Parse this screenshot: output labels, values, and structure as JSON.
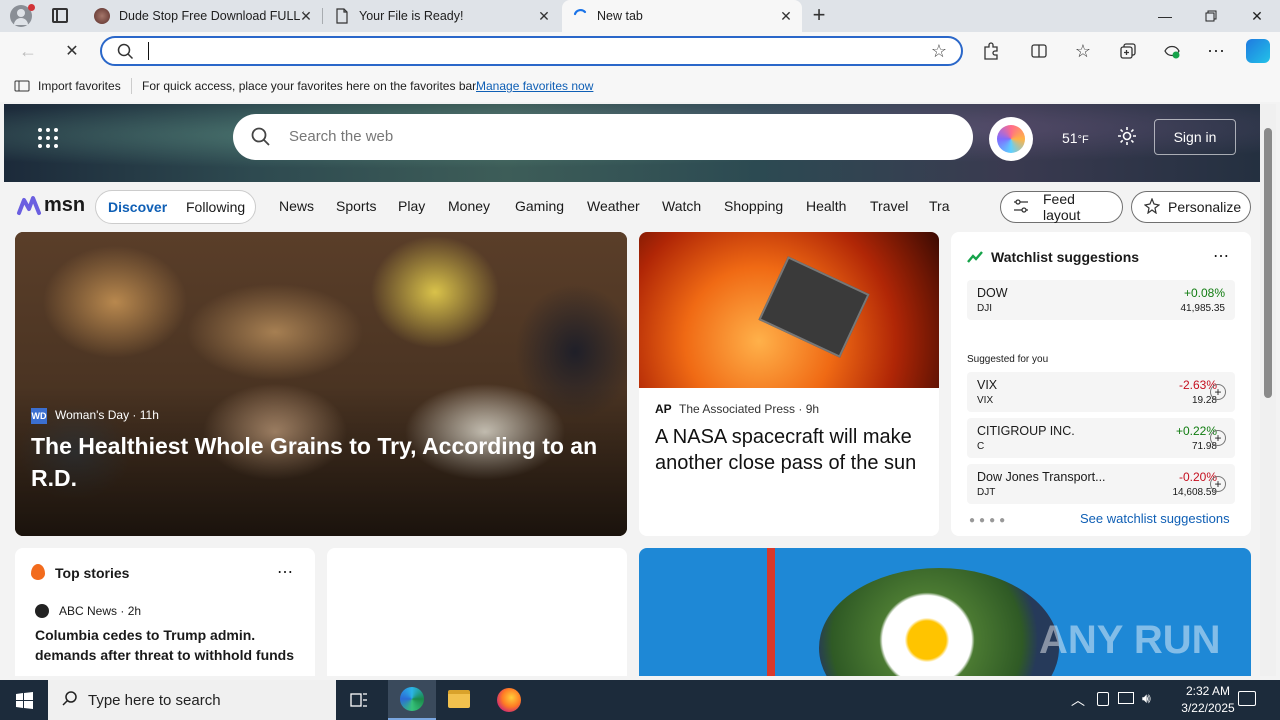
{
  "browser": {
    "tabs": [
      {
        "label": "Dude Stop Free Download FULL V",
        "active": false
      },
      {
        "label": "Your File is Ready!",
        "active": false
      },
      {
        "label": "New tab",
        "active": true
      }
    ],
    "address_value": "",
    "favorites_bar": {
      "import_label": "Import favorites",
      "hint": "For quick access, place your favorites here on the favorites bar.",
      "manage_link": "Manage favorites now"
    }
  },
  "msn": {
    "search_placeholder": "Search the web",
    "temperature": "51",
    "temp_unit": "°F",
    "sign_in": "Sign in",
    "logo": "msn",
    "tabs": [
      "Discover",
      "Following"
    ],
    "nav": [
      "News",
      "Sports",
      "Play",
      "Money",
      "Gaming",
      "Weather",
      "Watch",
      "Shopping",
      "Health",
      "Travel",
      "Tra"
    ],
    "feed_layout": "Feed layout",
    "personalize": "Personalize",
    "hero_story": {
      "source": "Woman's Day",
      "age": "11h",
      "title": "The Healthiest Whole Grains to Try, According to an R.D."
    },
    "second_story": {
      "source": "The Associated Press",
      "age": "9h",
      "title": "A NASA spacecraft will make another close pass of the sun"
    },
    "watchlist": {
      "title": "Watchlist suggestions",
      "main": {
        "name": "DOW",
        "symbol": "DJI",
        "change": "+0.08%",
        "price": "41,985.35"
      },
      "suggested_label": "Suggested for you",
      "suggested": [
        {
          "name": "VIX",
          "symbol": "VIX",
          "change": "-2.63%",
          "price": "19.28",
          "dir": "down"
        },
        {
          "name": "CITIGROUP INC.",
          "symbol": "C",
          "change": "+0.22%",
          "price": "71.98",
          "dir": "up"
        },
        {
          "name": "Dow Jones Transport...",
          "symbol": "DJT",
          "change": "-0.20%",
          "price": "14,608.59",
          "dir": "down"
        }
      ],
      "see_link": "See watchlist suggestions"
    },
    "top_stories": {
      "title": "Top stories",
      "source": "ABC News",
      "age": "2h",
      "headline": "Columbia cedes to Trump admin. demands after threat to withhold funds"
    },
    "watermark": "ANY RUN"
  },
  "taskbar": {
    "search_placeholder": "Type here to search",
    "time": "2:32 AM",
    "date": "3/22/2025"
  }
}
